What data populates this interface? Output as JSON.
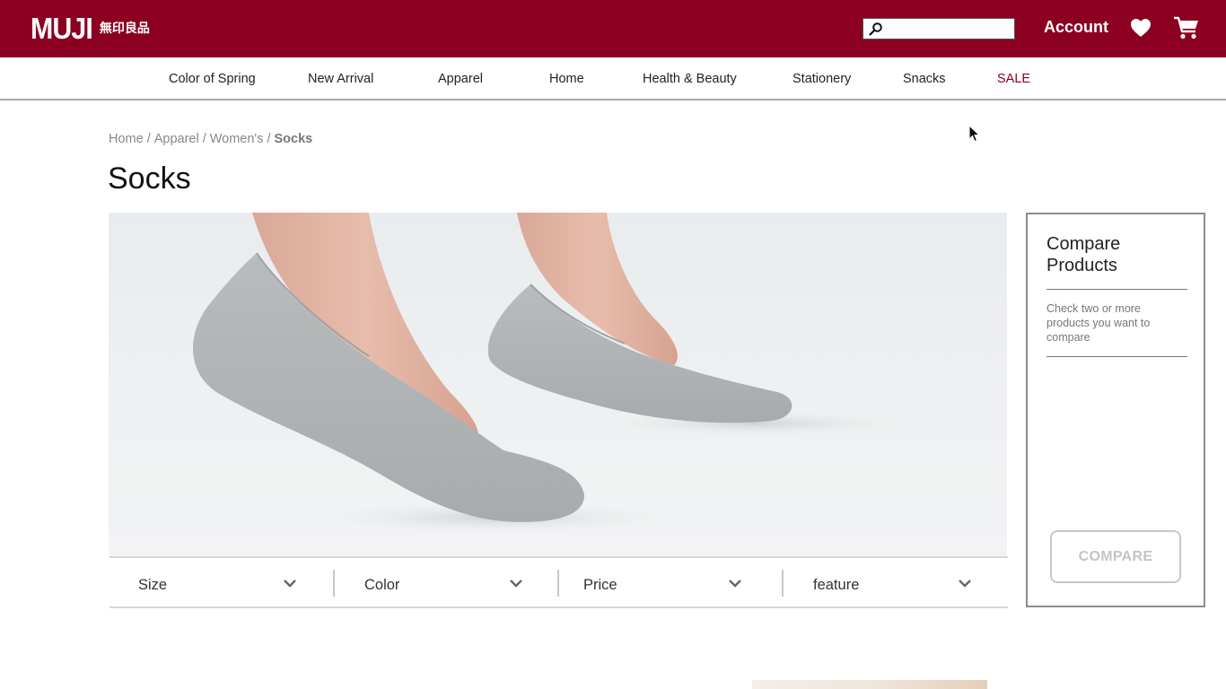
{
  "header": {
    "logo_text": "MUJI",
    "logo_jp": "無印良品",
    "search_placeholder": "",
    "search_value": "",
    "account_label": "Account",
    "heart_icon": "heart-icon",
    "cart_icon": "cart-icon",
    "brand_color": "#8b0020"
  },
  "nav": {
    "items": [
      {
        "label": "Color of Spring"
      },
      {
        "label": "New Arrival"
      },
      {
        "label": "Apparel"
      },
      {
        "label": "Home"
      },
      {
        "label": "Health & Beauty"
      },
      {
        "label": "Stationery"
      },
      {
        "label": "Snacks"
      },
      {
        "label": "SALE"
      }
    ]
  },
  "breadcrumb": {
    "items": [
      "Home",
      "Apparel",
      "Women's"
    ],
    "separator": "/",
    "current": "Socks"
  },
  "page": {
    "title": "Socks"
  },
  "filters": [
    {
      "label": "Size"
    },
    {
      "label": "Color"
    },
    {
      "label": "Price"
    },
    {
      "label": "feature"
    }
  ],
  "compare": {
    "title": "Compare Products",
    "hint": "Check two or more products you want to compare",
    "button_label": "COMPARE"
  }
}
